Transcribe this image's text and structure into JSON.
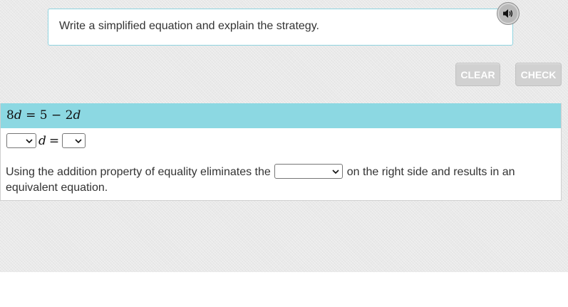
{
  "prompt": {
    "text": "Write a simplified equation and explain the strategy."
  },
  "audio": {
    "icon": "speaker-icon"
  },
  "buttons": {
    "clear": "CLEAR",
    "check": "CHECK"
  },
  "equation": {
    "lhs_coef": "8",
    "lhs_var": "d",
    "equals": "=",
    "rhs_const": "5",
    "minus": "−",
    "rhs_coef": "2",
    "rhs_var": "d"
  },
  "answer_row": {
    "variable": "d",
    "equals": "=",
    "coef_value": "",
    "rhs_value": ""
  },
  "statement": {
    "before": "Using the addition property of equality eliminates the",
    "after": "on the right side and results in an equivalent equation.",
    "dropdown_value": ""
  }
}
